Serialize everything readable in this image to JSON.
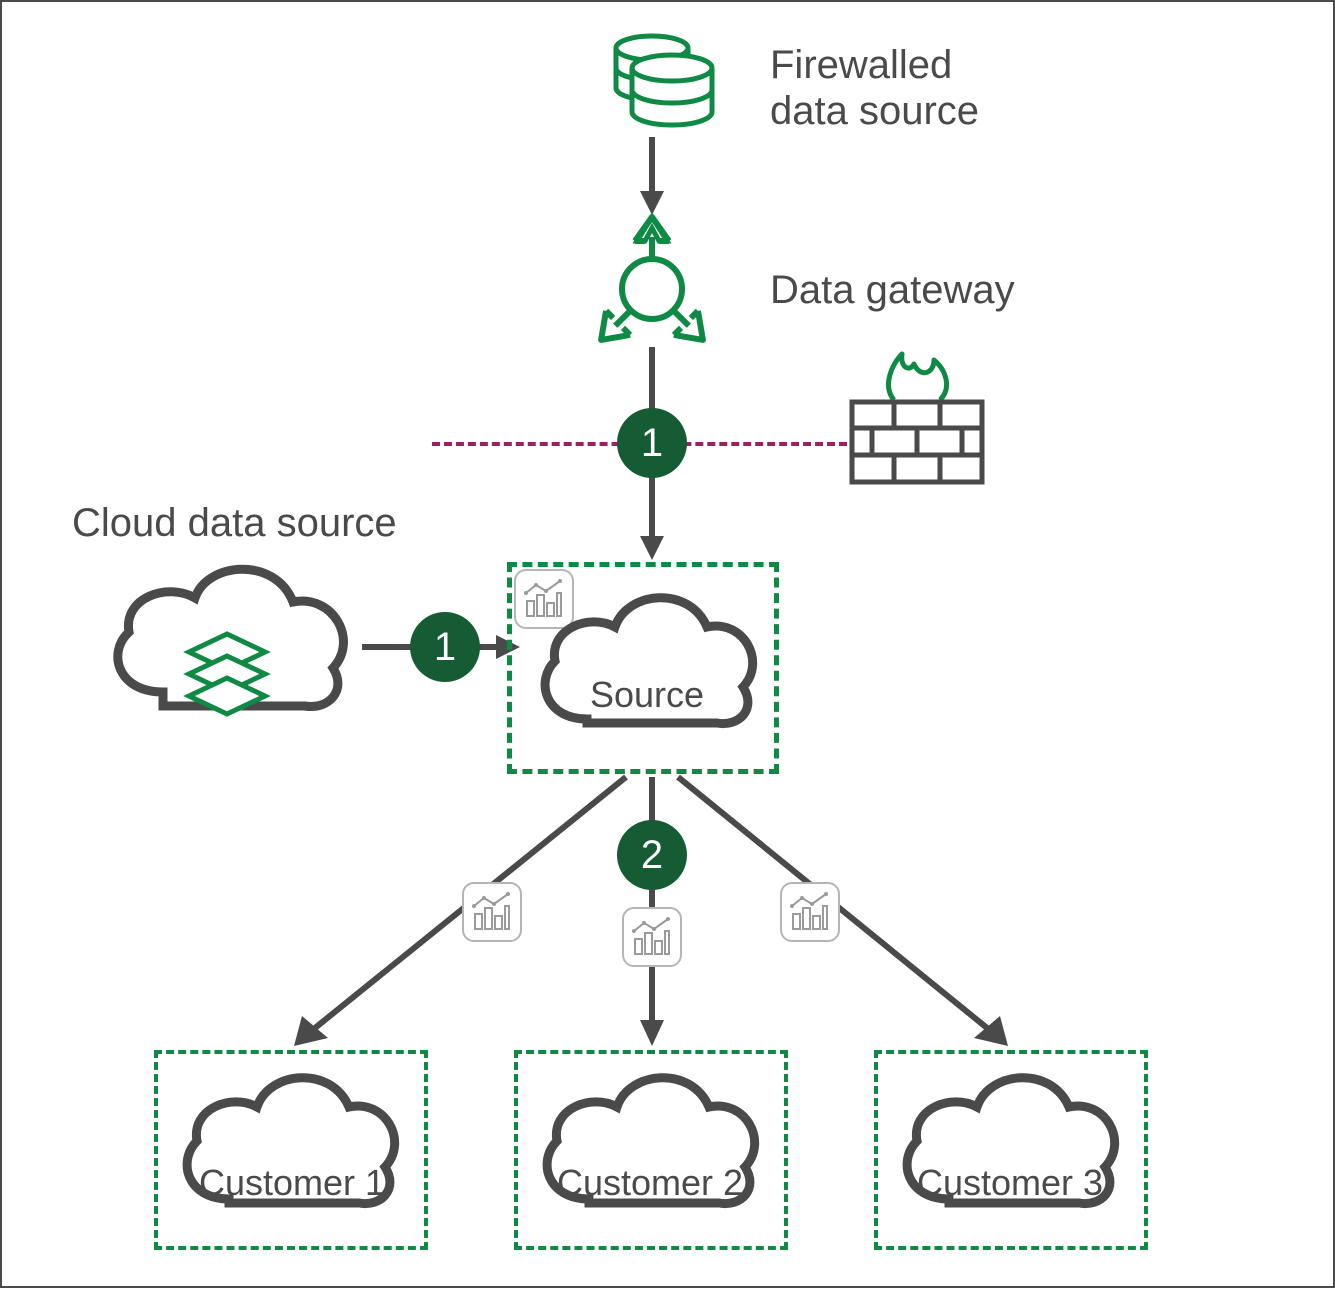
{
  "labels": {
    "firewalled": "Firewalled\ndata source",
    "gateway": "Data gateway",
    "cloud_source": "Cloud data source",
    "source_node": "Source",
    "customers": [
      "Customer 1",
      "Customer 2",
      "Customer 3"
    ]
  },
  "badges": {
    "top": "1",
    "left": "1",
    "center": "2"
  },
  "colors": {
    "accent_green": "#0e8a45",
    "dark_gray": "#4a4a4a",
    "badge_green": "#155c35",
    "firewall_magenta": "#9e1f63",
    "icon_gray": "#b5b5b5"
  }
}
